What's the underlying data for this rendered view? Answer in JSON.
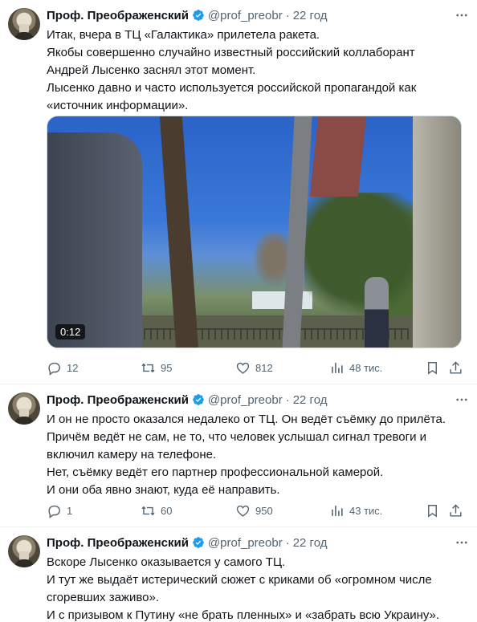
{
  "colors": {
    "text": "#0f1419",
    "secondary": "#536471",
    "verified": "#1d9bf0",
    "divider": "#eff3f4"
  },
  "tweets": [
    {
      "author": {
        "name": "Проф. Преображенский",
        "handle": "@prof_preobr",
        "time": "22 год"
      },
      "text_lines": [
        "Итак, вчера в ТЦ «Галактика» прилетела ракета.",
        "Якобы совершенно случайно известный российский коллаборант",
        "Андрей Лысенко заснял этот момент.",
        "Лысенко давно и часто используется российской пропагандой как",
        "«источник информации»."
      ],
      "media": {
        "duration": "0:12"
      },
      "stats": {
        "replies": "12",
        "retweets": "95",
        "likes": "812",
        "views": "48 тис."
      }
    },
    {
      "author": {
        "name": "Проф. Преображенский",
        "handle": "@prof_preobr",
        "time": "22 год"
      },
      "text_lines": [
        "И он не просто оказался недалеко от ТЦ. Он ведёт съёмку до прилёта.",
        "Причём ведёт не сам, не то, что человек услышал сигнал тревоги и",
        "включил камеру на телефоне.",
        "Нет, съёмку ведёт его партнер профессиональной камерой.",
        "И они оба явно знают, куда её направить."
      ],
      "stats": {
        "replies": "1",
        "retweets": "60",
        "likes": "950",
        "views": "43 тис."
      }
    },
    {
      "author": {
        "name": "Проф. Преображенский",
        "handle": "@prof_preobr",
        "time": "22 год"
      },
      "text_lines": [
        "Вскоре Лысенко оказывается у самого ТЦ.",
        "И тут же выдаёт истерический сюжет с криками об «огромном числе",
        "сгоревших заживо».",
        "И с призывом к Путину «не брать пленных» и «забрать всю Украину»."
      ]
    }
  ]
}
